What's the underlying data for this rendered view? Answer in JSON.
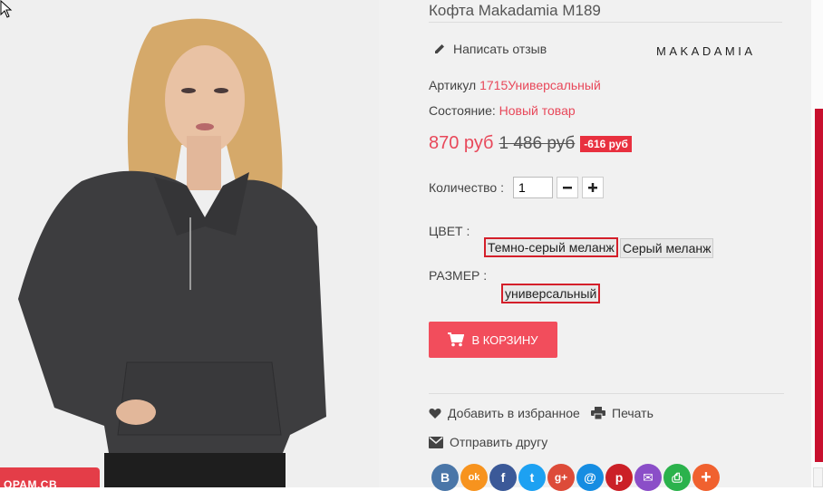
{
  "product": {
    "title": "Кофта Makadamia M189",
    "brand": "MAKADAMIA",
    "review_label": "Написать отзыв",
    "sku_label": "Артикул",
    "sku_value": "1715Универсальный",
    "condition_label": "Состояние:",
    "condition_value": "Новый товар",
    "price_current": "870 руб",
    "price_old": "1 486 руб",
    "discount": "-616 руб",
    "quantity_label": "Количество :",
    "quantity_value": "1",
    "color_label": "ЦВЕТ :",
    "colors": [
      "Темно-серый меланж",
      "Серый меланж"
    ],
    "size_label": "РАЗМЕР :",
    "sizes": [
      "универсальный"
    ],
    "cart_button": "В КОРЗИНУ",
    "wishlist_label": "Добавить в избранное",
    "print_label": "Печать",
    "send_friend_label": "Отправить другу"
  },
  "promo_badge": "ОРАМ.СВ",
  "social": [
    {
      "icon": "vk-icon",
      "glyph": "B",
      "color": "#4a76a8"
    },
    {
      "icon": "odnoklassniki-icon",
      "glyph": "ok",
      "color": "#f7931e"
    },
    {
      "icon": "facebook-icon",
      "glyph": "f",
      "color": "#3b5998"
    },
    {
      "icon": "twitter-icon",
      "glyph": "t",
      "color": "#1da1f2"
    },
    {
      "icon": "googleplus-icon",
      "glyph": "g+",
      "color": "#dd4b39"
    },
    {
      "icon": "mail-icon",
      "glyph": "@",
      "color": "#168de2"
    },
    {
      "icon": "pinterest-icon",
      "glyph": "p",
      "color": "#cb2027"
    },
    {
      "icon": "email-icon",
      "glyph": "✉",
      "color": "#8b4ec8"
    },
    {
      "icon": "print-share-icon",
      "glyph": "⎙",
      "color": "#2bb24c"
    },
    {
      "icon": "more-share-icon",
      "glyph": "+",
      "color": "#f0612f"
    }
  ]
}
